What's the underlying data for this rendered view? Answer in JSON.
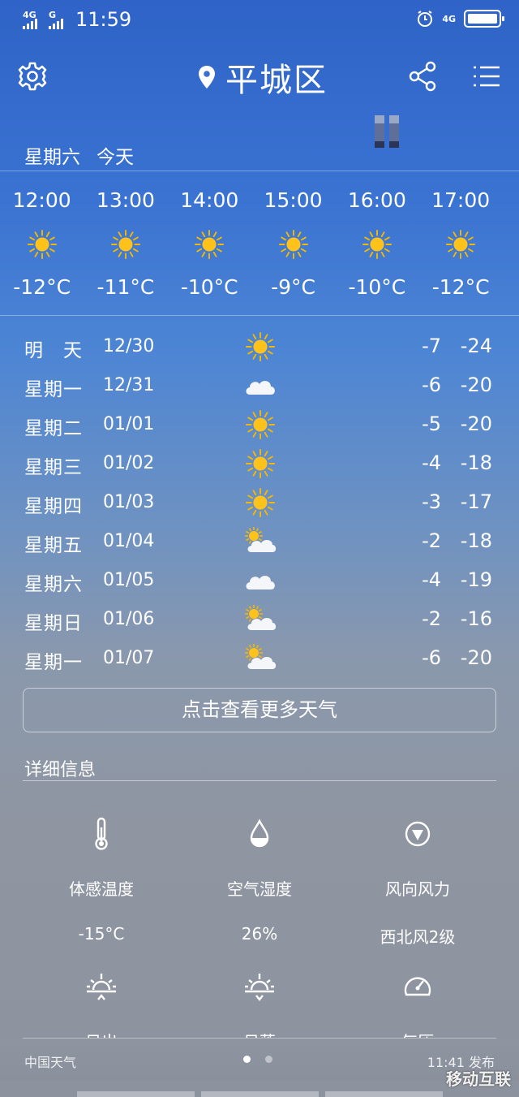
{
  "status": {
    "signal1": "4G",
    "signal2": "G",
    "time": "11:59",
    "net": "4G"
  },
  "header": {
    "location": "平城区"
  },
  "today": {
    "weekday": "星期六",
    "label": "今天"
  },
  "hourly": [
    {
      "time": "12:00",
      "icon": "sun",
      "temp": "-12°C"
    },
    {
      "time": "13:00",
      "icon": "sun",
      "temp": "-11°C"
    },
    {
      "time": "14:00",
      "icon": "sun",
      "temp": "-10°C"
    },
    {
      "time": "15:00",
      "icon": "sun",
      "temp": "-9°C"
    },
    {
      "time": "16:00",
      "icon": "sun",
      "temp": "-10°C"
    },
    {
      "time": "17:00",
      "icon": "sun",
      "temp": "-12°C"
    }
  ],
  "daily": [
    {
      "name": "明　天",
      "date": "12/30",
      "icon": "sun",
      "hi": "-7",
      "lo": "-24"
    },
    {
      "name": "星期一",
      "date": "12/31",
      "icon": "cloud",
      "hi": "-6",
      "lo": "-20"
    },
    {
      "name": "星期二",
      "date": "01/01",
      "icon": "sun",
      "hi": "-5",
      "lo": "-20"
    },
    {
      "name": "星期三",
      "date": "01/02",
      "icon": "sun",
      "hi": "-4",
      "lo": "-18"
    },
    {
      "name": "星期四",
      "date": "01/03",
      "icon": "sun",
      "hi": "-3",
      "lo": "-17"
    },
    {
      "name": "星期五",
      "date": "01/04",
      "icon": "partly-cloudy",
      "hi": "-2",
      "lo": "-18"
    },
    {
      "name": "星期六",
      "date": "01/05",
      "icon": "cloud",
      "hi": "-4",
      "lo": "-19"
    },
    {
      "name": "星期日",
      "date": "01/06",
      "icon": "partly-cloudy",
      "hi": "-2",
      "lo": "-16"
    },
    {
      "name": "星期一",
      "date": "01/07",
      "icon": "partly-cloudy",
      "hi": "-6",
      "lo": "-20"
    }
  ],
  "more_button": "点击查看更多天气",
  "details": {
    "title": "详细信息",
    "items": [
      {
        "icon": "thermometer-icon",
        "label": "体感温度",
        "value": "-15°C"
      },
      {
        "icon": "humidity-drop-icon",
        "label": "空气湿度",
        "value": "26%"
      },
      {
        "icon": "wind-direction-icon",
        "label": "风向风力",
        "value": "西北风2级"
      },
      {
        "icon": "sunrise-icon",
        "label": "日出",
        "value": ""
      },
      {
        "icon": "sunset-icon",
        "label": "日落",
        "value": ""
      },
      {
        "icon": "pressure-gauge-icon",
        "label": "气压",
        "value": ""
      }
    ]
  },
  "footer": {
    "source": "中国天气",
    "published": "11:41 发布"
  },
  "watermark": "移动互联"
}
